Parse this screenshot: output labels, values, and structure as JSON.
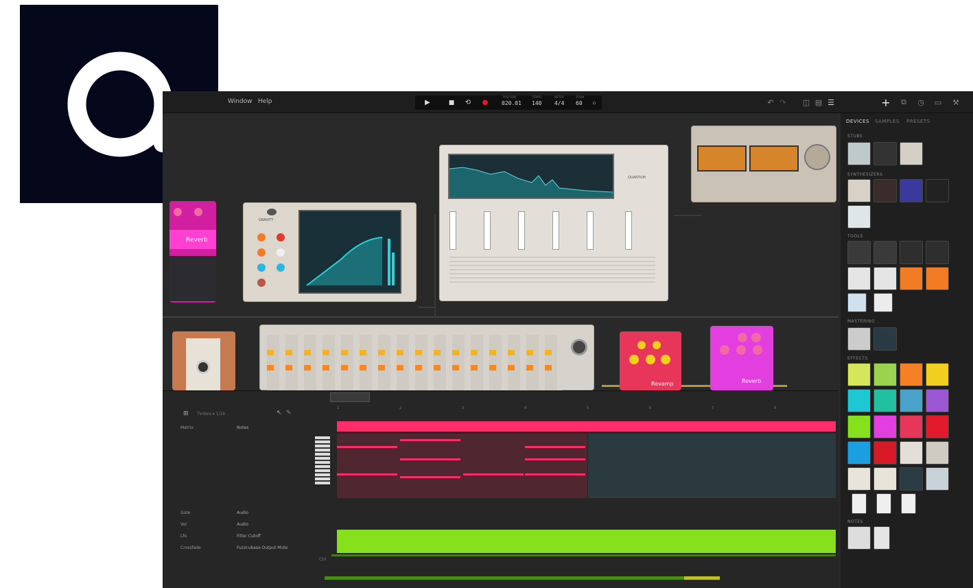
{
  "brand": {
    "bg": "#05081a",
    "fg": "#ffffff"
  },
  "menu": {
    "window": "Window",
    "help": "Help"
  },
  "transport": {
    "play": "▶",
    "stop": "■",
    "loop": "⟲",
    "record": "●",
    "position": "020.01",
    "tempo": "140",
    "meter": "4/4",
    "zoom": "60",
    "pos_label": "POSITION",
    "tempo_label": "TEMPO",
    "meter_label": "METER",
    "zoom_label": "ZOOM"
  },
  "panel": {
    "tabs": [
      "DEVICES",
      "SAMPLES",
      "PRESETS"
    ],
    "sections": [
      "STUBS",
      "SYNTHESIZERS",
      "TOOLS",
      "MASTERING",
      "EFFECTS",
      "NOTES"
    ]
  },
  "devices": {
    "gravity": "GRAVITY",
    "quantum": "QUANTUM",
    "revamp": "Revamp",
    "reverb": "Reverb"
  },
  "sequencer": {
    "title": "Timbre ▾ 1/16",
    "tracks": [
      {
        "name": "Matrix",
        "type": "Notes"
      },
      {
        "name": "Gate",
        "type": "Audio"
      },
      {
        "name": "Vol",
        "type": "Audio"
      },
      {
        "name": "Lfo",
        "type": "Filter Cutoff"
      },
      {
        "name": "Crossfade",
        "type": "Fuzzcubase Output Mute"
      }
    ],
    "bars": [
      "1",
      "2",
      "3",
      "4",
      "5",
      "6",
      "7",
      "8"
    ],
    "lane_label": "Ctrl"
  },
  "colors": {
    "accent": "#ff2d6a",
    "green": "#86e01e",
    "vu": "#d6852a"
  }
}
